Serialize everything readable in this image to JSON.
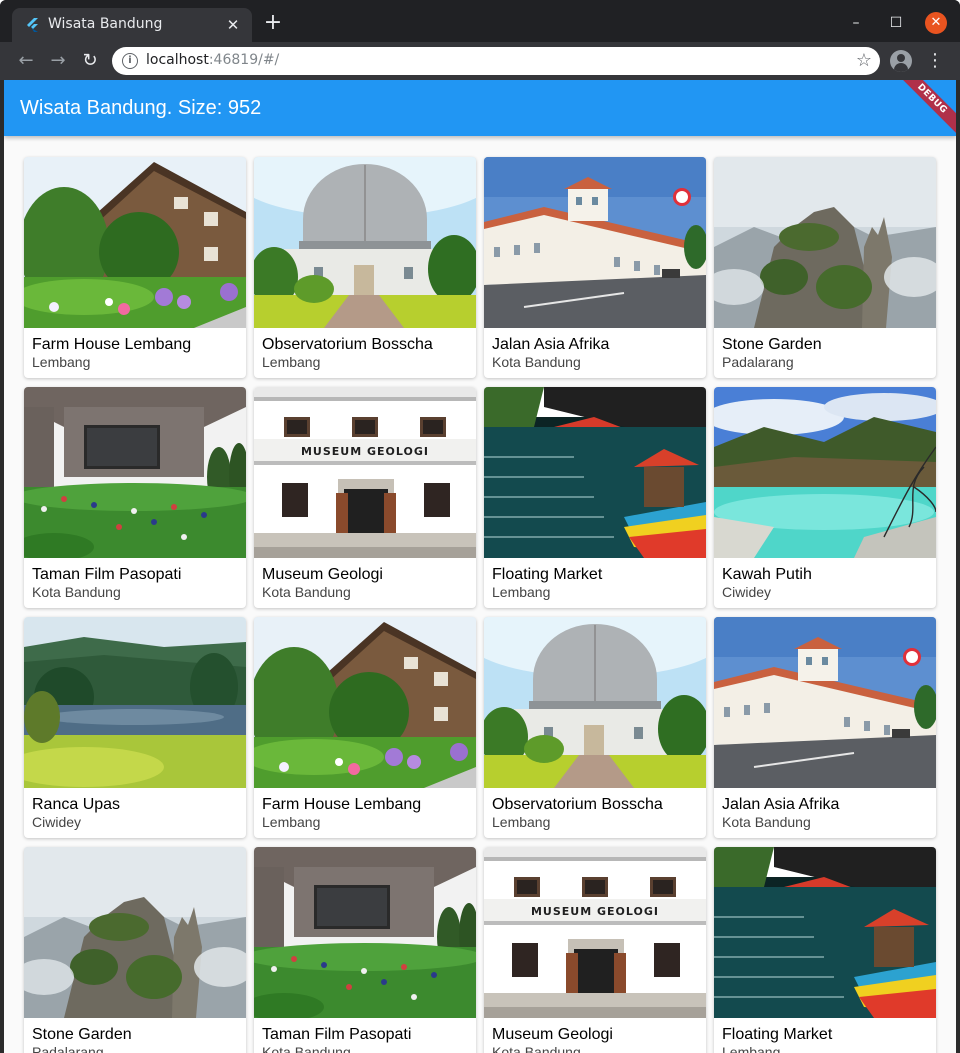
{
  "browser": {
    "tab_title": "Wisata Bandung",
    "url_host": "localhost",
    "url_rest": ":46819/#/"
  },
  "app": {
    "title": "Wisata Bandung. Size: 952",
    "debug_label": "DEBUG"
  },
  "places": [
    {
      "name": "Farm House Lembang",
      "location": "Lembang",
      "scene": "farmhouse"
    },
    {
      "name": "Observatorium Bosscha",
      "location": "Lembang",
      "scene": "observatory"
    },
    {
      "name": "Jalan Asia Afrika",
      "location": "Kota Bandung",
      "scene": "street"
    },
    {
      "name": "Stone Garden",
      "location": "Padalarang",
      "scene": "stone"
    },
    {
      "name": "Taman Film Pasopati",
      "location": "Kota Bandung",
      "scene": "park"
    },
    {
      "name": "Museum Geologi",
      "location": "Kota Bandung",
      "scene": "museum"
    },
    {
      "name": "Floating Market",
      "location": "Lembang",
      "scene": "market"
    },
    {
      "name": "Kawah Putih",
      "location": "Ciwidey",
      "scene": "crater"
    },
    {
      "name": "Ranca Upas",
      "location": "Ciwidey",
      "scene": "lake"
    },
    {
      "name": "Farm House Lembang",
      "location": "Lembang",
      "scene": "farmhouse"
    },
    {
      "name": "Observatorium Bosscha",
      "location": "Lembang",
      "scene": "observatory"
    },
    {
      "name": "Jalan Asia Afrika",
      "location": "Kota Bandung",
      "scene": "street"
    },
    {
      "name": "Stone Garden",
      "location": "Padalarang",
      "scene": "stone"
    },
    {
      "name": "Taman Film Pasopati",
      "location": "Kota Bandung",
      "scene": "park"
    },
    {
      "name": "Museum Geologi",
      "location": "Kota Bandung",
      "scene": "museum"
    },
    {
      "name": "Floating Market",
      "location": "Lembang",
      "scene": "market"
    }
  ],
  "museum_sign": "MUSEUM GEOLOGI",
  "colors": {
    "appbar": "#2196f3",
    "window_close": "#e95420"
  }
}
